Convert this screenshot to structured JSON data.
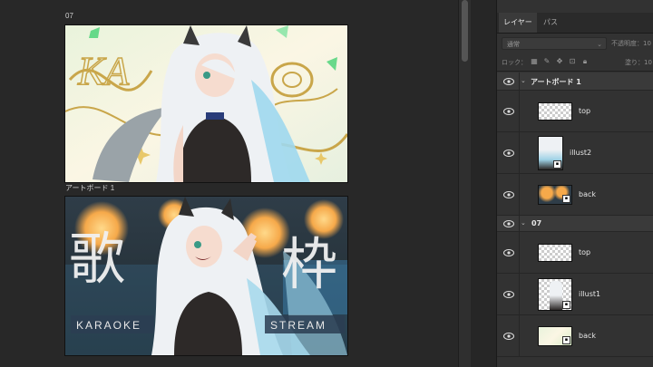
{
  "canvas": {
    "artboard_07_label": "07",
    "artboard_1_label": "アートボード 1",
    "karaoke_kanji_left": "歌",
    "karaoke_kanji_right": "枠",
    "karaoke_word": "KARAOKE",
    "stream_word": "STREAM"
  },
  "layers_panel": {
    "tabs": [
      {
        "label": "レイヤー"
      },
      {
        "label": "パス"
      }
    ],
    "blend_mode": "通常",
    "opacity_label": "不透明度：10",
    "lock_label": "ロック：",
    "fill_label": "塗り：10",
    "groups": [
      {
        "name": "アートボード 1",
        "layers": [
          {
            "name": "top"
          },
          {
            "name": "illust2"
          },
          {
            "name": "back"
          }
        ]
      },
      {
        "name": "07",
        "layers": [
          {
            "name": "top"
          },
          {
            "name": "illust1"
          },
          {
            "name": "back"
          }
        ]
      }
    ]
  },
  "colors": {
    "canvas_bg": "#282828",
    "panel_bg": "#323232",
    "group_row_bg": "#3a3a3a",
    "accent_gold": "#c9a64a",
    "accent_green": "#4fd47a"
  }
}
